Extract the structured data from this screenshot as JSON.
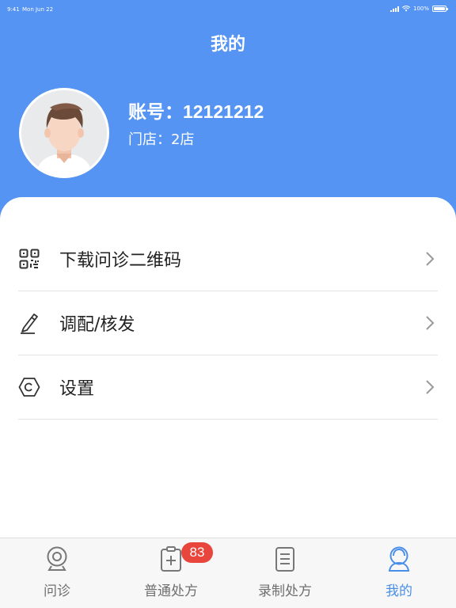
{
  "status_bar": {
    "time": "9:41",
    "date": "Mon Jun 22",
    "battery": "100%"
  },
  "header": {
    "title": "我的",
    "account_label": "账号：",
    "account_value": "12121212",
    "store_label": "门店：",
    "store_value": "2店",
    "bg_color": "#5594f2"
  },
  "menu": {
    "items": [
      {
        "label": "下载问诊二维码",
        "icon": "qr-code-icon"
      },
      {
        "label": "调配/核发",
        "icon": "pencil-icon"
      },
      {
        "label": "设置",
        "icon": "settings-hexagon-icon"
      }
    ]
  },
  "tabbar": {
    "tabs": [
      {
        "label": "问诊",
        "icon": "webcam-icon",
        "active": false
      },
      {
        "label": "普通处方",
        "icon": "prescription-icon",
        "active": false,
        "badge": "83"
      },
      {
        "label": "录制处方",
        "icon": "document-icon",
        "active": false
      },
      {
        "label": "我的",
        "icon": "user-icon",
        "active": true
      }
    ],
    "active_color": "#4a8fe7",
    "badge_color": "#e8453c"
  }
}
